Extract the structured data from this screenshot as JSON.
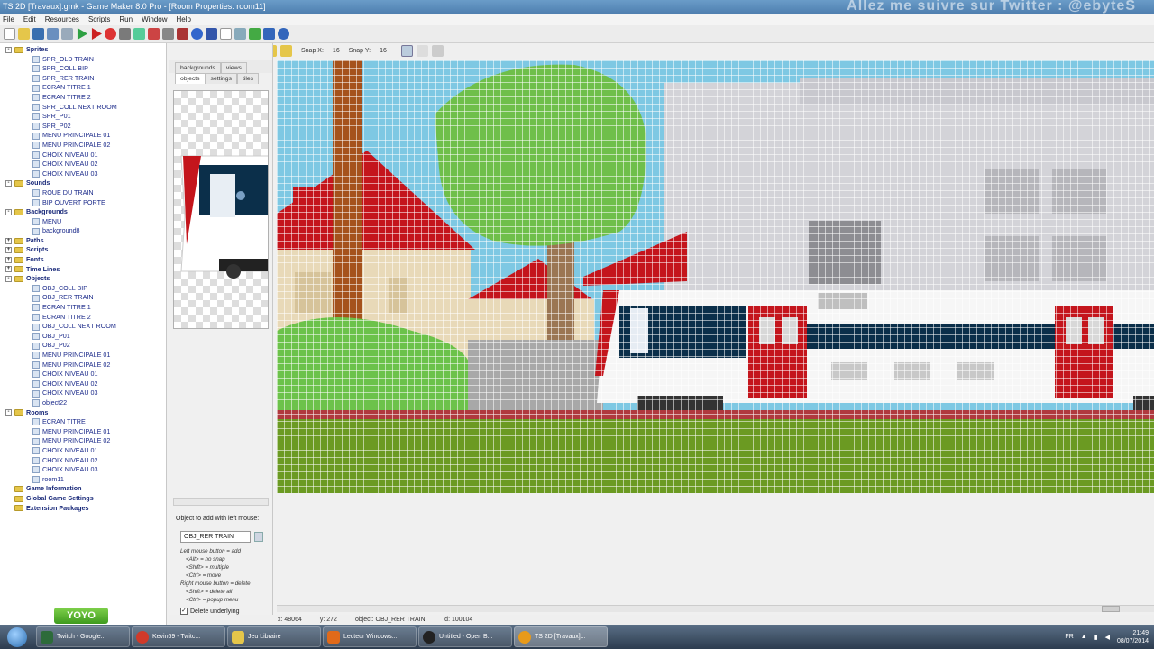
{
  "window": {
    "title": "TS 2D [Travaux].gmk - Game Maker 8.0 Pro - [Room Properties: room11]",
    "overlay_text": "Allez me suivre sur Twitter : @ebyteS"
  },
  "menu": [
    "File",
    "Edit",
    "Resources",
    "Scripts",
    "Run",
    "Window",
    "Help"
  ],
  "tree": [
    {
      "label": "Sprites",
      "kind": "folder",
      "toggle": "-"
    },
    {
      "label": "SPR_OLD TRAIN",
      "kind": "item"
    },
    {
      "label": "SPR_COLL BIP",
      "kind": "item"
    },
    {
      "label": "SPR_RER TRAIN",
      "kind": "item"
    },
    {
      "label": "ECRAN TITRE 1",
      "kind": "item"
    },
    {
      "label": "ECRAN TITRE 2",
      "kind": "item"
    },
    {
      "label": "SPR_COLL NEXT ROOM",
      "kind": "item"
    },
    {
      "label": "SPR_P01",
      "kind": "item"
    },
    {
      "label": "SPR_P02",
      "kind": "item"
    },
    {
      "label": "MENU PRINCIPALE 01",
      "kind": "item"
    },
    {
      "label": "MENU PRINCIPALE 02",
      "kind": "item"
    },
    {
      "label": "CHOIX NIVEAU 01",
      "kind": "item"
    },
    {
      "label": "CHOIX NIVEAU 02",
      "kind": "item"
    },
    {
      "label": "CHOIX NIVEAU 03",
      "kind": "item"
    },
    {
      "label": "Sounds",
      "kind": "folder",
      "toggle": "-"
    },
    {
      "label": "ROUE DU TRAIN",
      "kind": "item"
    },
    {
      "label": "BIP OUVERT PORTE",
      "kind": "item"
    },
    {
      "label": "Backgrounds",
      "kind": "folder",
      "toggle": "-"
    },
    {
      "label": "MENU",
      "kind": "item"
    },
    {
      "label": "background8",
      "kind": "item"
    },
    {
      "label": "Paths",
      "kind": "folder",
      "toggle": "+"
    },
    {
      "label": "Scripts",
      "kind": "folder",
      "toggle": "+"
    },
    {
      "label": "Fonts",
      "kind": "folder",
      "toggle": "+"
    },
    {
      "label": "Time Lines",
      "kind": "folder",
      "toggle": "+"
    },
    {
      "label": "Objects",
      "kind": "folder",
      "toggle": "-"
    },
    {
      "label": "OBJ_COLL BIP",
      "kind": "item"
    },
    {
      "label": "OBJ_RER TRAIN",
      "kind": "item"
    },
    {
      "label": "ECRAN TITRE 1",
      "kind": "item"
    },
    {
      "label": "ECRAN TITRE 2",
      "kind": "item"
    },
    {
      "label": "OBJ_COLL NEXT ROOM",
      "kind": "item"
    },
    {
      "label": "OBJ_P01",
      "kind": "item"
    },
    {
      "label": "OBJ_P02",
      "kind": "item"
    },
    {
      "label": "MENU PRINCIPALE 01",
      "kind": "item"
    },
    {
      "label": "MENU PRINCIPALE 02",
      "kind": "item"
    },
    {
      "label": "CHOIX NIVEAU 01",
      "kind": "item"
    },
    {
      "label": "CHOIX NIVEAU 02",
      "kind": "item"
    },
    {
      "label": "CHOIX NIVEAU 03",
      "kind": "item"
    },
    {
      "label": "object22",
      "kind": "item"
    },
    {
      "label": "Rooms",
      "kind": "folder",
      "toggle": "-"
    },
    {
      "label": "ECRAN TITRE",
      "kind": "item"
    },
    {
      "label": "MENU PRINCIPALE 01",
      "kind": "item"
    },
    {
      "label": "MENU PRINCIPALE 02",
      "kind": "item"
    },
    {
      "label": "CHOIX NIVEAU 01",
      "kind": "item"
    },
    {
      "label": "CHOIX NIVEAU 02",
      "kind": "item"
    },
    {
      "label": "CHOIX NIVEAU 03",
      "kind": "item"
    },
    {
      "label": "room11",
      "kind": "item"
    },
    {
      "label": "Game Information",
      "kind": "folder-plain"
    },
    {
      "label": "Global Game Settings",
      "kind": "folder-plain"
    },
    {
      "label": "Extension Packages",
      "kind": "folder-plain"
    }
  ],
  "branding": {
    "logo": "YOYO GAMES"
  },
  "props": {
    "tabs_top": [
      "backgrounds",
      "views"
    ],
    "tabs_bottom": [
      "objects",
      "settings",
      "tiles"
    ],
    "object_label": "Object to add with left mouse:",
    "object_value": "OBJ_RER TRAIN",
    "instructions": [
      "Left mouse button = add",
      "  <Alt> = no snap",
      "  <Shift> = multiple",
      "  <Ctrl> = move",
      "Right mouse button = delete",
      "  <Shift> = delete all",
      "  <Ctrl> = popup menu"
    ],
    "delete_underlying": "Delete underlying"
  },
  "room_toolbar": {
    "snap_x_label": "Snap X:",
    "snap_x": "16",
    "snap_y_label": "Snap Y:",
    "snap_y": "16"
  },
  "status": {
    "x": "x: 48064",
    "y": "y: 272",
    "object": "object: OBJ_RER TRAIN",
    "id": "id: 100104"
  },
  "taskbar": {
    "tasks": [
      "Twitch - Google...",
      "Kevin69 - Twitc...",
      "Jeu Libraire",
      "Lecteur Windows...",
      "Untitled - Open B...",
      "TS 2D [Travaux]..."
    ],
    "lang": "FR",
    "time": "21:49",
    "date": "08/07/2014"
  },
  "colors": {
    "sky": "#7ec8e3",
    "grass": "#6b9a22",
    "roof": "#c4151c",
    "tree": "#6fbf4a",
    "brand": "#5ab52a"
  }
}
